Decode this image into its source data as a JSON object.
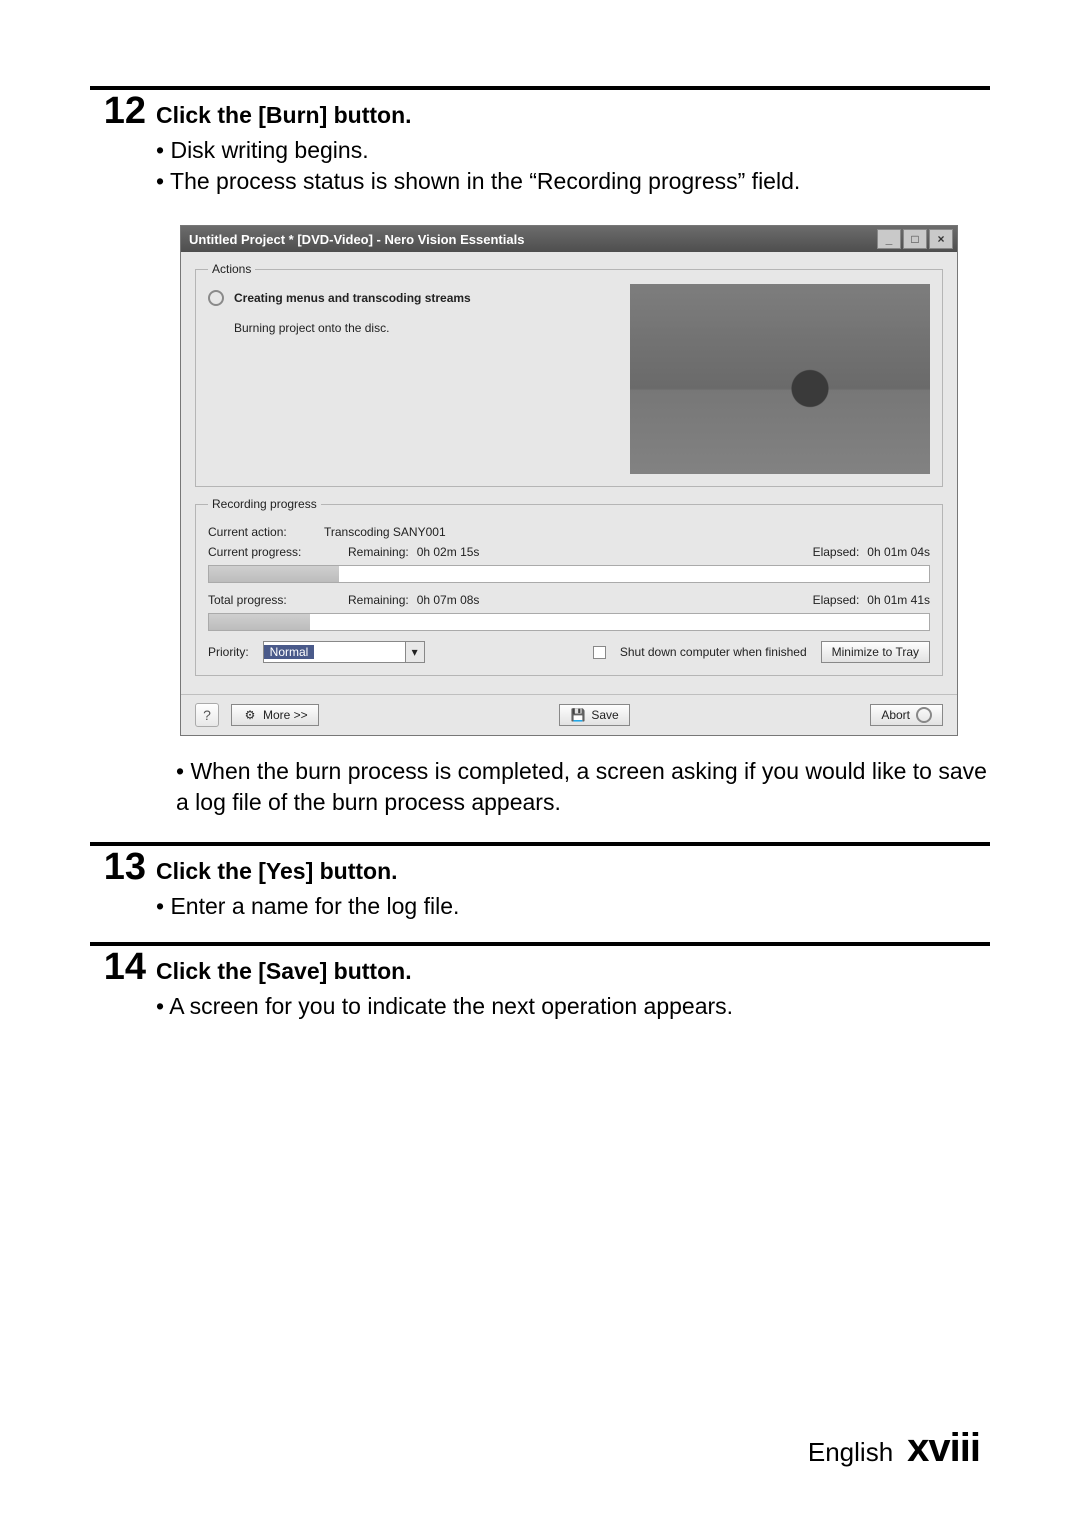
{
  "step12": {
    "num": "12",
    "title": "Click the [Burn] button.",
    "bullets": [
      "Disk writing begins.",
      "The process status is shown in the “Recording progress” field."
    ],
    "after_bullets": [
      "When the burn process is completed, a screen asking if you would like to save a log file of the burn process appears."
    ]
  },
  "step13": {
    "num": "13",
    "title": "Click the [Yes] button.",
    "bullets": [
      "Enter a name for the log file."
    ]
  },
  "step14": {
    "num": "14",
    "title": "Click the [Save] button.",
    "bullets": [
      "A screen for you to indicate the next operation appears."
    ]
  },
  "screenshot": {
    "window_title": "Untitled Project * [DVD-Video] - Nero Vision Essentials",
    "actions_legend": "Actions",
    "action1": "Creating menus and transcoding streams",
    "action2": "Burning project onto the disc.",
    "rp_legend": "Recording progress",
    "current_action_label": "Current action:",
    "current_action_value": "Transcoding SANY001",
    "current_progress_label": "Current progress:",
    "cp_remaining_label": "Remaining:",
    "cp_remaining_value": "0h 02m 15s",
    "cp_elapsed_label": "Elapsed:",
    "cp_elapsed_value": "0h 01m 04s",
    "total_progress_label": "Total progress:",
    "tp_remaining_label": "Remaining:",
    "tp_remaining_value": "0h 07m 08s",
    "tp_elapsed_label": "Elapsed:",
    "tp_elapsed_value": "0h 01m 41s",
    "priority_label": "Priority:",
    "priority_value": "Normal",
    "shutdown_label": "Shut down computer when finished",
    "minimize_label": "Minimize to Tray",
    "help_icon": "?",
    "more_label": "More >>",
    "save_label": "Save",
    "abort_label": "Abort"
  },
  "footer": {
    "language": "English",
    "page": "xviii"
  }
}
